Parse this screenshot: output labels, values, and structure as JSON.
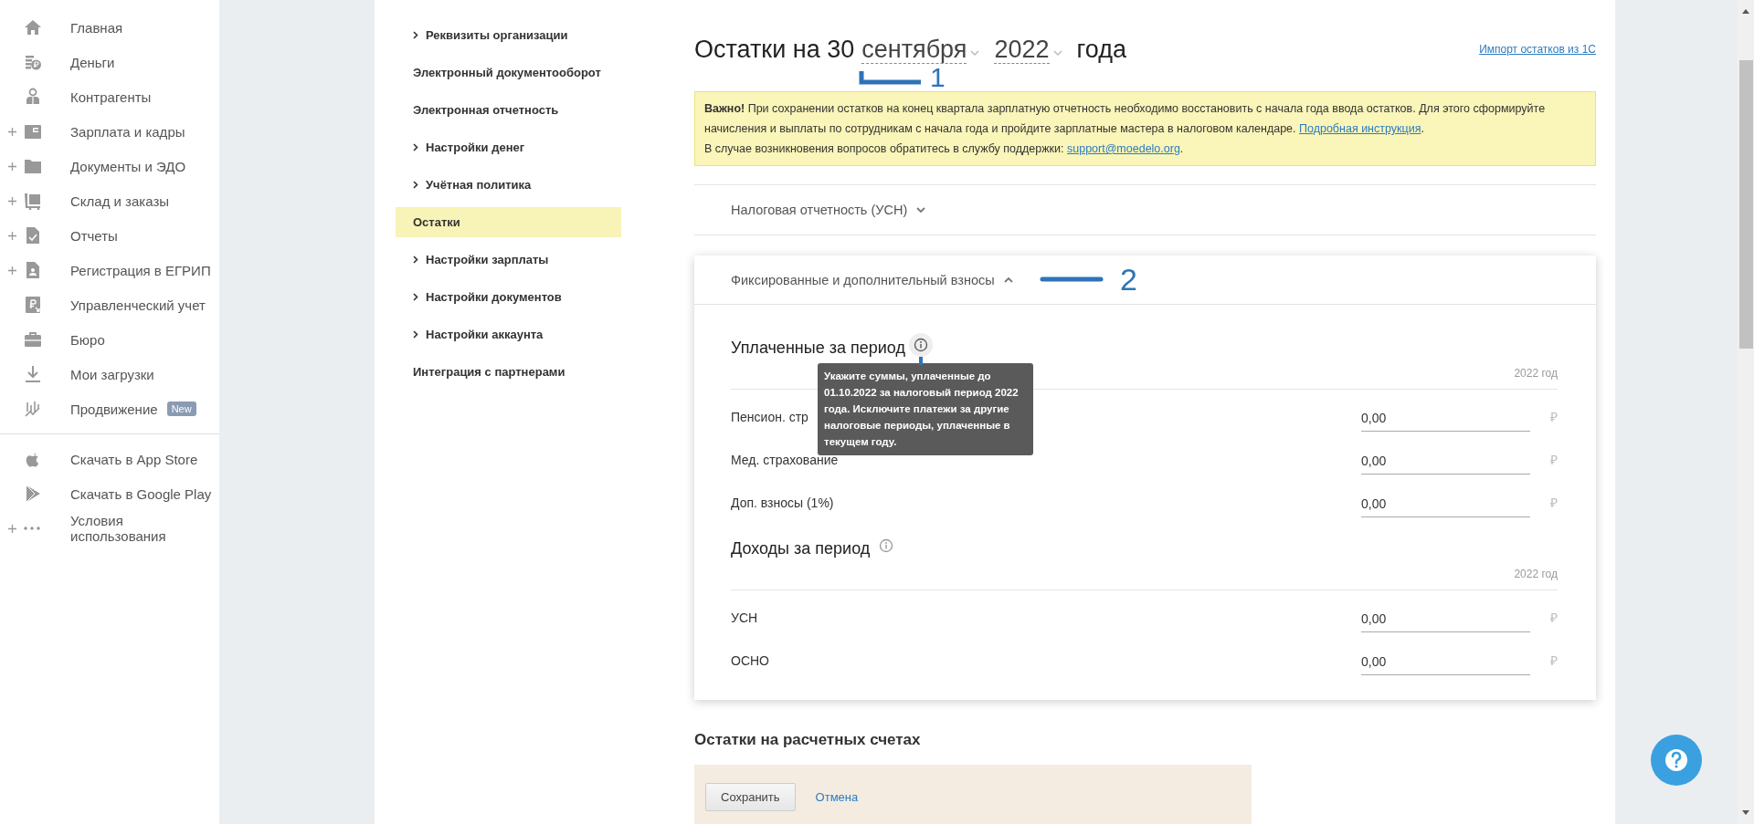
{
  "sidebar": {
    "items": [
      {
        "label": "Главная",
        "expandable": false
      },
      {
        "label": "Деньги",
        "expandable": false
      },
      {
        "label": "Контрагенты",
        "expandable": false
      },
      {
        "label": "Зарплата и кадры",
        "expandable": true
      },
      {
        "label": "Документы и ЭДО",
        "expandable": true
      },
      {
        "label": "Склад и заказы",
        "expandable": true
      },
      {
        "label": "Отчеты",
        "expandable": true
      },
      {
        "label": "Регистрация в ЕГРИП",
        "expandable": true
      },
      {
        "label": "Управленческий учет",
        "expandable": false
      },
      {
        "label": "Бюро",
        "expandable": false
      },
      {
        "label": "Мои загрузки",
        "expandable": false
      },
      {
        "label": "Продвижение",
        "expandable": false,
        "badge": "New"
      }
    ],
    "apps": [
      {
        "label": "Скачать в App Store",
        "expandable": false
      },
      {
        "label": "Скачать в Google Play",
        "expandable": false
      },
      {
        "label": "Условия использования",
        "expandable": true
      }
    ]
  },
  "settings_menu": [
    {
      "label": "Реквизиты организации",
      "has_submenu": true,
      "selected": false
    },
    {
      "label": "Электронный документооборот",
      "has_submenu": false,
      "selected": false
    },
    {
      "label": "Электронная отчетность",
      "has_submenu": false,
      "selected": false
    },
    {
      "label": "Настройки денег",
      "has_submenu": true,
      "selected": false
    },
    {
      "label": "Учётная политика",
      "has_submenu": true,
      "selected": false
    },
    {
      "label": "Остатки",
      "has_submenu": false,
      "selected": true
    },
    {
      "label": "Настройки зарплаты",
      "has_submenu": true,
      "selected": false
    },
    {
      "label": "Настройки документов",
      "has_submenu": true,
      "selected": false
    },
    {
      "label": "Настройки аккаунта",
      "has_submenu": true,
      "selected": false
    },
    {
      "label": "Интеграция с партнерами",
      "has_submenu": false,
      "selected": false
    }
  ],
  "header": {
    "title_prefix": "Остатки на 30",
    "month": "сентября",
    "year": "2022",
    "title_suffix": "года",
    "import_link": "Импорт остатков из 1С"
  },
  "notice": {
    "paragraphs": [
      {
        "text": "**Важно!** При сохранении остатков на конец квартала зарплатную отчетность необходимо восстановить с начала года ввода остатков. Для этого сформируйте начисления и выплаты по сотрудникам с начала года и пройдите зарплатные мастера в налоговом календаре. ",
        "link": "Подробная инструкция",
        "after": "."
      },
      {
        "text": "В случае возникновения вопросов обратитесь в службу поддержки: ",
        "link": "support@moedelo.org",
        "after": "."
      }
    ]
  },
  "accordions": [
    {
      "title": "Налоговая отчетность (УСН)",
      "expanded": false
    },
    {
      "title": "Фиксированные и дополнительный взносы",
      "expanded": true,
      "sections": [
        {
          "title": "Уплаченные за период",
          "period": "2022 год",
          "tooltip": "Укажите суммы, уплаченные до 01.10.2022 за налоговый период 2022 года. Исключите платежи за другие налоговые периоды, уплаченные в текущем году.",
          "rows": [
            {
              "label": "Пенсион. стр",
              "value": "0,00",
              "currency": "₽"
            },
            {
              "label": "Мед. страхование",
              "value": "0,00",
              "currency": "₽"
            },
            {
              "label": "Доп. взносы (1%)",
              "value": "0,00",
              "currency": "₽"
            }
          ]
        },
        {
          "title": "Доходы за период",
          "period": "2022 год",
          "rows": [
            {
              "label": "УСН",
              "value": "0,00",
              "currency": "₽"
            },
            {
              "label": "ОСНО",
              "value": "0,00",
              "currency": "₽"
            }
          ]
        }
      ]
    }
  ],
  "annotations": [
    {
      "label": "1"
    },
    {
      "label": "2"
    }
  ],
  "accounts": {
    "title": "Остатки на расчетных счетах",
    "save": "Сохранить",
    "cancel": "Отмена"
  }
}
